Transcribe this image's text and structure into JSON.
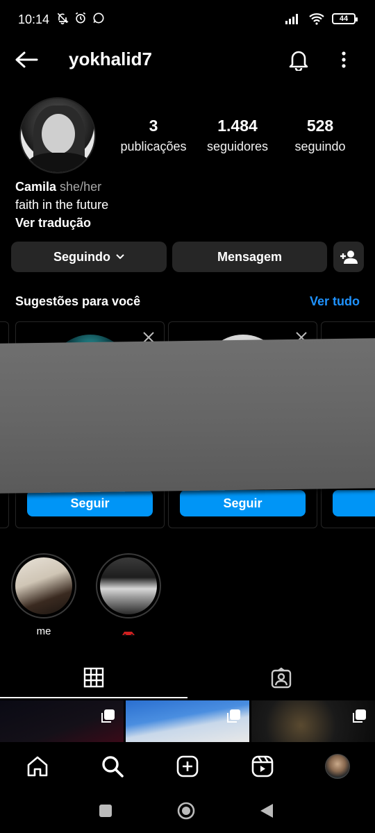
{
  "status_bar": {
    "time": "10:14",
    "battery": "44"
  },
  "header": {
    "username": "yokhalid7"
  },
  "stats": [
    {
      "value": "3",
      "label": "publicações"
    },
    {
      "value": "1.484",
      "label": "seguidores"
    },
    {
      "value": "528",
      "label": "seguindo"
    }
  ],
  "bio": {
    "name": "Camila",
    "pronouns": "she/her",
    "text": "faith in the future",
    "translate": "Ver tradução"
  },
  "actions": {
    "following": "Seguindo",
    "message": "Mensagem"
  },
  "suggestions": {
    "title": "Sugestões para você",
    "see_all": "Ver tudo",
    "follow_label": "Seguir"
  },
  "highlights": [
    {
      "caption": "me"
    },
    {
      "caption": ""
    }
  ],
  "colors": {
    "accent": "#0095f6",
    "link": "#1f93ff",
    "button_bg": "#262626"
  }
}
